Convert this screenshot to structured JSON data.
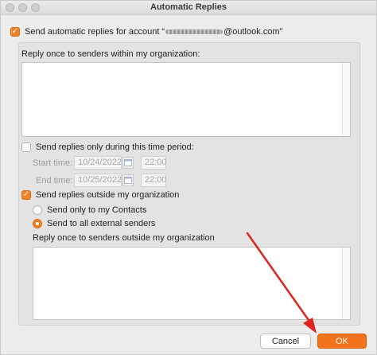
{
  "window": {
    "title": "Automatic Replies"
  },
  "send_auto": {
    "prefix": "Send automatic replies for account “",
    "suffix": "@outlook.com”",
    "checked": true
  },
  "internal": {
    "label": "Reply once to senders within my organization:"
  },
  "period": {
    "label": "Send replies only during this time period:",
    "checked": false,
    "start_label": "Start time:",
    "start_date": "10/24/2022",
    "start_time": "22:00",
    "end_label": "End time:",
    "end_date": "10/25/2022",
    "end_time": "22:00"
  },
  "external": {
    "label": "Send replies outside my organization",
    "checked": true,
    "option_contacts": "Send only to my Contacts",
    "option_all": "Send to all external senders",
    "selected": "Send to all external senders",
    "reply_label": "Reply once to senders outside my organization"
  },
  "buttons": {
    "cancel": "Cancel",
    "ok": "OK"
  },
  "colors": {
    "accent": "#f2731c",
    "annotation_arrow": "#e0231c"
  },
  "icons": {
    "checkbox": "checkmark-icon",
    "calendar": "calendar-icon"
  }
}
